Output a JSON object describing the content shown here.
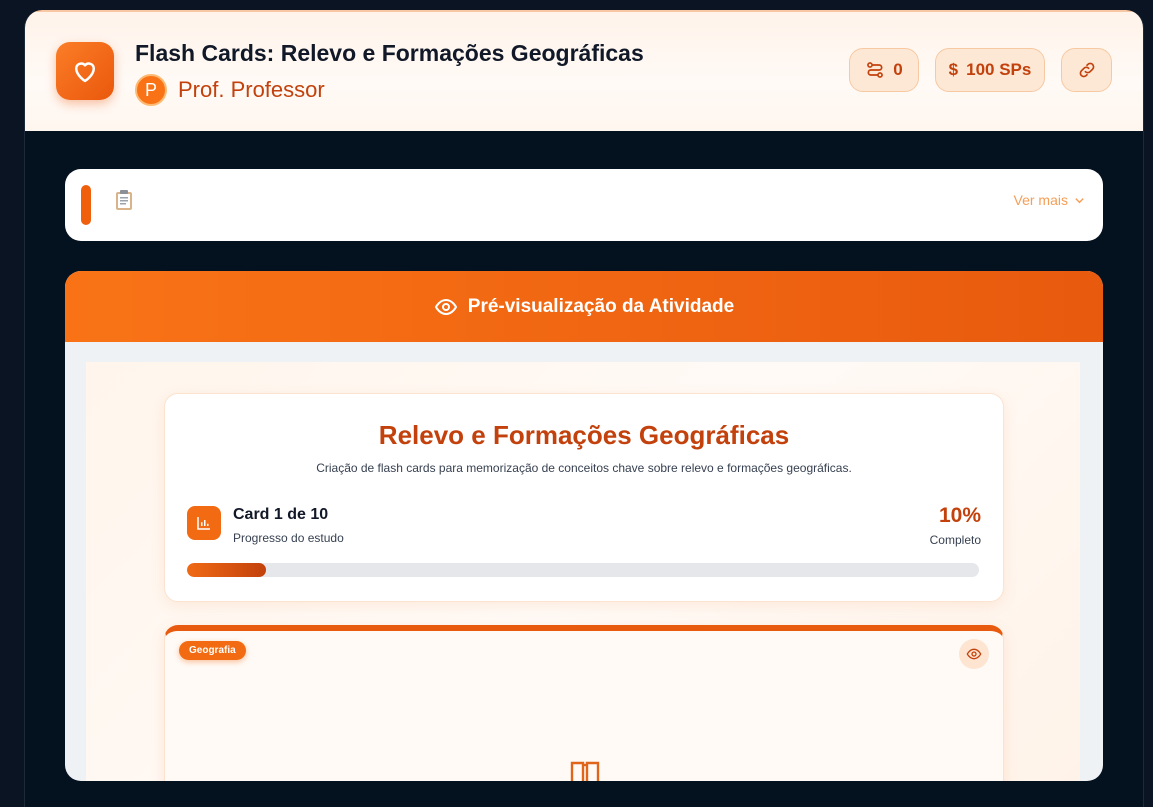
{
  "header": {
    "title": "Flash Cards: Relevo e Formações Geográficas",
    "avatar_initial": "P",
    "author": "Prof. Professor",
    "stats": {
      "connections": "0",
      "points": "100 SPs",
      "currency_symbol": "$"
    }
  },
  "description": {
    "ver_mais": "Ver mais"
  },
  "preview": {
    "heading": "Pré-visualização da Atividade",
    "activity_title": "Relevo e Formações Geográficas",
    "activity_subtitle": "Criação de flash cards para memorização de conceitos chave sobre relevo e formações geográficas.",
    "card_count": "Card 1 de 10",
    "progress_label": "Progresso do estudo",
    "percent": "10%",
    "percent_label": "Completo",
    "progress_value": 0.1,
    "card_badge": "Geografia"
  },
  "colors": {
    "accent": "#f97316",
    "accent_dark": "#c2410c"
  }
}
